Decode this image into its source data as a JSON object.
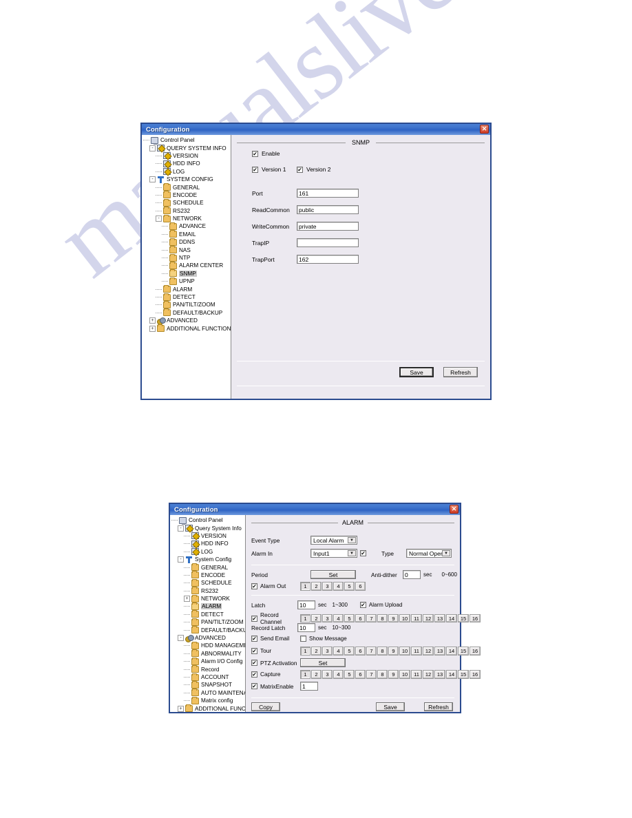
{
  "page": {
    "watermark": "manualslive.com"
  },
  "dialog_snmp": {
    "title": "Configuration",
    "close_label": "✕",
    "section_title": "SNMP",
    "tree": [
      {
        "label": "Control Panel",
        "icon": "monitor-icon",
        "indent": 0,
        "expander": "",
        "selected": false
      },
      {
        "label": "QUERY SYSTEM INFO",
        "icon": "clipboard-icon",
        "indent": 1,
        "expander": "-",
        "selected": false
      },
      {
        "label": "VERSION",
        "icon": "clipboard-icon",
        "indent": 2,
        "expander": "",
        "selected": false
      },
      {
        "label": "HDD INFO",
        "icon": "clipboard-icon",
        "indent": 2,
        "expander": "",
        "selected": false
      },
      {
        "label": "LOG",
        "icon": "clipboard-icon",
        "indent": 2,
        "expander": "",
        "selected": false
      },
      {
        "label": "SYSTEM CONFIG",
        "icon": "tool-icon",
        "indent": 1,
        "expander": "-",
        "selected": false
      },
      {
        "label": "GENERAL",
        "icon": "folder-icon",
        "indent": 2,
        "expander": "",
        "selected": false
      },
      {
        "label": "ENCODE",
        "icon": "folder-icon",
        "indent": 2,
        "expander": "",
        "selected": false
      },
      {
        "label": "SCHEDULE",
        "icon": "folder-icon",
        "indent": 2,
        "expander": "",
        "selected": false
      },
      {
        "label": "RS232",
        "icon": "folder-icon",
        "indent": 2,
        "expander": "",
        "selected": false
      },
      {
        "label": "NETWORK",
        "icon": "folder-icon",
        "indent": 2,
        "expander": "-",
        "selected": false
      },
      {
        "label": "ADVANCE",
        "icon": "folder-icon",
        "indent": 3,
        "expander": "",
        "selected": false
      },
      {
        "label": "EMAIL",
        "icon": "folder-icon",
        "indent": 3,
        "expander": "",
        "selected": false
      },
      {
        "label": "DDNS",
        "icon": "folder-icon",
        "indent": 3,
        "expander": "",
        "selected": false
      },
      {
        "label": "NAS",
        "icon": "folder-icon",
        "indent": 3,
        "expander": "",
        "selected": false
      },
      {
        "label": "NTP",
        "icon": "folder-icon",
        "indent": 3,
        "expander": "",
        "selected": false
      },
      {
        "label": "ALARM CENTER",
        "icon": "folder-icon",
        "indent": 3,
        "expander": "",
        "selected": false
      },
      {
        "label": "SNMP",
        "icon": "folder-open-icon",
        "indent": 3,
        "expander": "",
        "selected": true
      },
      {
        "label": "UPNP",
        "icon": "folder-icon",
        "indent": 3,
        "expander": "",
        "selected": false
      },
      {
        "label": "ALARM",
        "icon": "folder-icon",
        "indent": 2,
        "expander": "",
        "selected": false
      },
      {
        "label": "DETECT",
        "icon": "folder-icon",
        "indent": 2,
        "expander": "",
        "selected": false
      },
      {
        "label": "PAN/TILT/ZOOM",
        "icon": "folder-icon",
        "indent": 2,
        "expander": "",
        "selected": false
      },
      {
        "label": "DEFAULT/BACKUP",
        "icon": "folder-icon",
        "indent": 2,
        "expander": "",
        "selected": false
      },
      {
        "label": "ADVANCED",
        "icon": "gears-icon",
        "indent": 1,
        "expander": "+",
        "selected": false
      },
      {
        "label": "ADDITIONAL FUNCTION",
        "icon": "folder-icon",
        "indent": 1,
        "expander": "+",
        "selected": false
      }
    ],
    "enable": {
      "label": "Enable",
      "checked": true
    },
    "version1": {
      "label": "Version 1",
      "checked": true
    },
    "version2": {
      "label": "Version 2",
      "checked": true
    },
    "fields": [
      {
        "label": "Port",
        "value": "161"
      },
      {
        "label": "ReadCommon",
        "value": "public"
      },
      {
        "label": "WriteCommon",
        "value": "private"
      },
      {
        "label": "TrapIP",
        "value": ""
      },
      {
        "label": "TrapPort",
        "value": "162"
      }
    ],
    "buttons": {
      "save": "Save",
      "refresh": "Refresh"
    }
  },
  "dialog_alarm": {
    "title": "Configuration",
    "close_label": "✕",
    "section_title": "ALARM",
    "tree": [
      {
        "label": "Control Panel",
        "icon": "monitor-icon",
        "indent": 0,
        "expander": "",
        "selected": false
      },
      {
        "label": "Query System Info",
        "icon": "clipboard-icon",
        "indent": 1,
        "expander": "-",
        "selected": false
      },
      {
        "label": "VERSION",
        "icon": "clipboard-icon",
        "indent": 2,
        "expander": "",
        "selected": false
      },
      {
        "label": "HDD INFO",
        "icon": "clipboard-icon",
        "indent": 2,
        "expander": "",
        "selected": false
      },
      {
        "label": "LOG",
        "icon": "clipboard-icon",
        "indent": 2,
        "expander": "",
        "selected": false
      },
      {
        "label": "System Config",
        "icon": "tool-icon",
        "indent": 1,
        "expander": "-",
        "selected": false
      },
      {
        "label": "GENERAL",
        "icon": "folder-icon",
        "indent": 2,
        "expander": "",
        "selected": false
      },
      {
        "label": "ENCODE",
        "icon": "folder-icon",
        "indent": 2,
        "expander": "",
        "selected": false
      },
      {
        "label": "SCHEDULE",
        "icon": "folder-icon",
        "indent": 2,
        "expander": "",
        "selected": false
      },
      {
        "label": "RS232",
        "icon": "folder-icon",
        "indent": 2,
        "expander": "",
        "selected": false
      },
      {
        "label": "NETWORK",
        "icon": "folder-icon",
        "indent": 2,
        "expander": "+",
        "selected": false
      },
      {
        "label": "ALARM",
        "icon": "folder-open-icon",
        "indent": 2,
        "expander": "",
        "selected": true
      },
      {
        "label": "DETECT",
        "icon": "folder-icon",
        "indent": 2,
        "expander": "",
        "selected": false
      },
      {
        "label": "PAN/TILT/ZOOM",
        "icon": "folder-icon",
        "indent": 2,
        "expander": "",
        "selected": false
      },
      {
        "label": "DEFAULT/BACKUP",
        "icon": "folder-icon",
        "indent": 2,
        "expander": "",
        "selected": false
      },
      {
        "label": "ADVANCED",
        "icon": "gears-icon",
        "indent": 1,
        "expander": "-",
        "selected": false
      },
      {
        "label": "HDD MANAGEMENT",
        "icon": "folder-icon",
        "indent": 2,
        "expander": "",
        "selected": false
      },
      {
        "label": "ABNORMALITY",
        "icon": "folder-icon",
        "indent": 2,
        "expander": "",
        "selected": false
      },
      {
        "label": "Alarm I/O Config",
        "icon": "folder-icon",
        "indent": 2,
        "expander": "",
        "selected": false
      },
      {
        "label": "Record",
        "icon": "folder-icon",
        "indent": 2,
        "expander": "",
        "selected": false
      },
      {
        "label": "ACCOUNT",
        "icon": "folder-icon",
        "indent": 2,
        "expander": "",
        "selected": false
      },
      {
        "label": "SNAPSHOT",
        "icon": "folder-icon",
        "indent": 2,
        "expander": "",
        "selected": false
      },
      {
        "label": "AUTO MAINTENANCE",
        "icon": "folder-icon",
        "indent": 2,
        "expander": "",
        "selected": false
      },
      {
        "label": "Matrix config",
        "icon": "folder-icon",
        "indent": 2,
        "expander": "",
        "selected": false
      },
      {
        "label": "ADDITIONAL FUNCTION",
        "icon": "folder-icon",
        "indent": 1,
        "expander": "+",
        "selected": false
      }
    ],
    "event_type": {
      "label": "Event Type",
      "value": "Local Alarm"
    },
    "alarm_in": {
      "label": "Alarm In",
      "value": "Input1",
      "checked": true
    },
    "type": {
      "label": "Type",
      "value": "Normal Open"
    },
    "period": {
      "label": "Period",
      "button": "Set"
    },
    "antidither": {
      "label": "Anti-dither",
      "value": "0",
      "unit": "sec",
      "range": "0~600"
    },
    "alarm_out": {
      "label": "Alarm Out",
      "checked": true,
      "channels": [
        "1",
        "2",
        "3",
        "4",
        "5",
        "6"
      ],
      "active": [
        "1"
      ]
    },
    "latch": {
      "label": "Latch",
      "value": "10",
      "unit": "sec",
      "range": "1~300"
    },
    "alarm_upload": {
      "label": "Alarm Upload",
      "checked": true
    },
    "record_channel": {
      "label": "Record Channel",
      "checked": true,
      "channels": [
        "1",
        "2",
        "3",
        "4",
        "5",
        "6",
        "7",
        "8",
        "9",
        "10",
        "11",
        "12",
        "13",
        "14",
        "15",
        "16"
      ],
      "active": [
        "1"
      ]
    },
    "record_latch": {
      "label": "Record Latch",
      "value": "10",
      "unit": "sec",
      "range": "10~300"
    },
    "send_email": {
      "label": "Send Email",
      "checked": true
    },
    "show_message": {
      "label": "Show Message",
      "checked": false
    },
    "tour": {
      "label": "Tour",
      "checked": true,
      "channels": [
        "1",
        "2",
        "3",
        "4",
        "5",
        "6",
        "7",
        "8",
        "9",
        "10",
        "11",
        "12",
        "13",
        "14",
        "15",
        "16"
      ],
      "active": [
        "1"
      ]
    },
    "ptz_activation": {
      "label": "PTZ Activation",
      "checked": true,
      "button": "Set"
    },
    "capture": {
      "label": "Capture",
      "checked": true,
      "channels": [
        "1",
        "2",
        "3",
        "4",
        "5",
        "6",
        "7",
        "8",
        "9",
        "10",
        "11",
        "12",
        "13",
        "14",
        "15",
        "16"
      ],
      "active": [
        "1"
      ]
    },
    "matrix_enable": {
      "label": "MatrixEnable",
      "checked": true,
      "value": "1"
    },
    "buttons": {
      "copy": "Copy",
      "save": "Save",
      "refresh": "Refresh"
    }
  }
}
